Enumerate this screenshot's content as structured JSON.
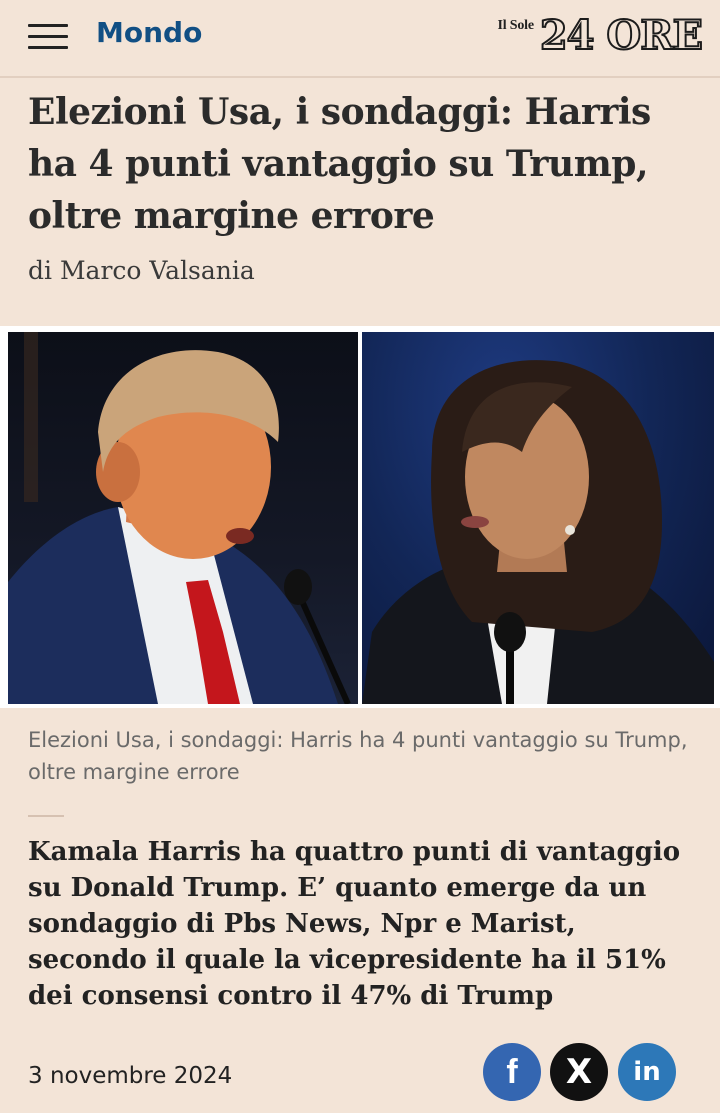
{
  "header": {
    "section": "Mondo",
    "logo_small": "Il Sole",
    "logo_big": "24 ORE"
  },
  "article": {
    "headline": "Elezioni Usa, i sondaggi: Harris ha 4 punti vantaggio su Trump, oltre margine errore",
    "author": "di Marco Valsania",
    "caption": "Elezioni Usa, i sondaggi: Harris ha 4 punti vantaggio su Trump, oltre margine errore",
    "lede": "Kamala Harris ha quattro punti di vantaggio su Donald Trump. E’ quanto emerge da un sondaggio di Pbs News, Npr e Marist, secondo il quale la vicepresidente ha il 51% dei consensi contro il 47% di Trump",
    "date": "3 novembre 2024"
  },
  "share": {
    "facebook_icon": "f",
    "x_icon": "X",
    "linkedin_icon": "in"
  },
  "colors": {
    "background": "#f3e4d7",
    "section_link": "#114f84",
    "facebook": "#3466b1",
    "x": "#111111",
    "linkedin": "#2d78b8"
  },
  "icons": [
    "hamburger-menu-icon",
    "facebook-icon",
    "x-twitter-icon",
    "linkedin-icon"
  ]
}
